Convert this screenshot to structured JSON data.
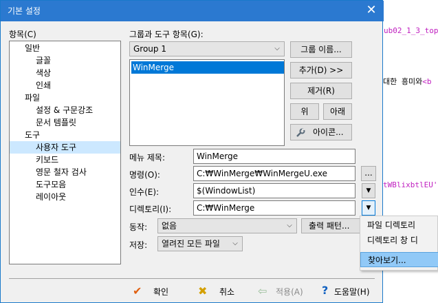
{
  "background_editor": {
    "line1": "ub02_1_3_top",
    "line2_text": "대한 흥미와",
    "line2_tag": "<b",
    "line3": "tWBlixbtlEU'"
  },
  "dialog": {
    "title": "기본 설정",
    "close_glyph": "✕"
  },
  "categories": {
    "label": "항목(C)",
    "tree": [
      {
        "label": "일반",
        "level": 0
      },
      {
        "label": "글꼴",
        "level": 1
      },
      {
        "label": "색상",
        "level": 1
      },
      {
        "label": "인쇄",
        "level": 1
      },
      {
        "label": "파일",
        "level": 0
      },
      {
        "label": "설정 & 구문강조",
        "level": 1
      },
      {
        "label": "문서 템플릿",
        "level": 1
      },
      {
        "label": "도구",
        "level": 0
      },
      {
        "label": "사용자 도구",
        "level": 1,
        "selected": true
      },
      {
        "label": "키보드",
        "level": 1
      },
      {
        "label": "영문 철자 검사",
        "level": 1
      },
      {
        "label": "도구모음",
        "level": 1
      },
      {
        "label": "레이아웃",
        "level": 1
      }
    ]
  },
  "group": {
    "label": "그룹과 도구 항목(G):",
    "selected_group": "Group 1",
    "list_items": [
      "WinMerge"
    ],
    "rename_button": "그룹 이름...",
    "add_button": "추가(D) >>",
    "remove_button": "제거(R)",
    "up_button": "위",
    "down_button": "아래",
    "icon_button": "아이콘..."
  },
  "fields": {
    "menu_title_label": "메뉴 제목:",
    "menu_title_value": "WinMerge",
    "command_label": "명령(O):",
    "command_value": "C:₩WinMerge₩WinMergeU.exe",
    "browse_button": "...",
    "args_label": "인수(E):",
    "args_value": "$(WindowList)",
    "dir_label": "디렉토리(I):",
    "dir_value": "C:₩WinMerge",
    "action_label": "동작:",
    "action_value": "없음",
    "output_pattern_button": "출력 패턴...",
    "save_label": "저장:",
    "save_value": "열려진 모든 파일"
  },
  "dropdown_menu": {
    "items": [
      "파일 디렉토리",
      "디렉토리 창 디",
      "찾아보기..."
    ],
    "highlighted_index": 2
  },
  "footer": {
    "ok": "확인",
    "cancel": "취소",
    "apply": "적용(A)",
    "help": "도움말(H)"
  },
  "colors": {
    "titlebar": "#2b79d0",
    "selection": "#0078d7",
    "tree_selection": "#cce8ff",
    "menu_highlight": "#91c9f7"
  }
}
